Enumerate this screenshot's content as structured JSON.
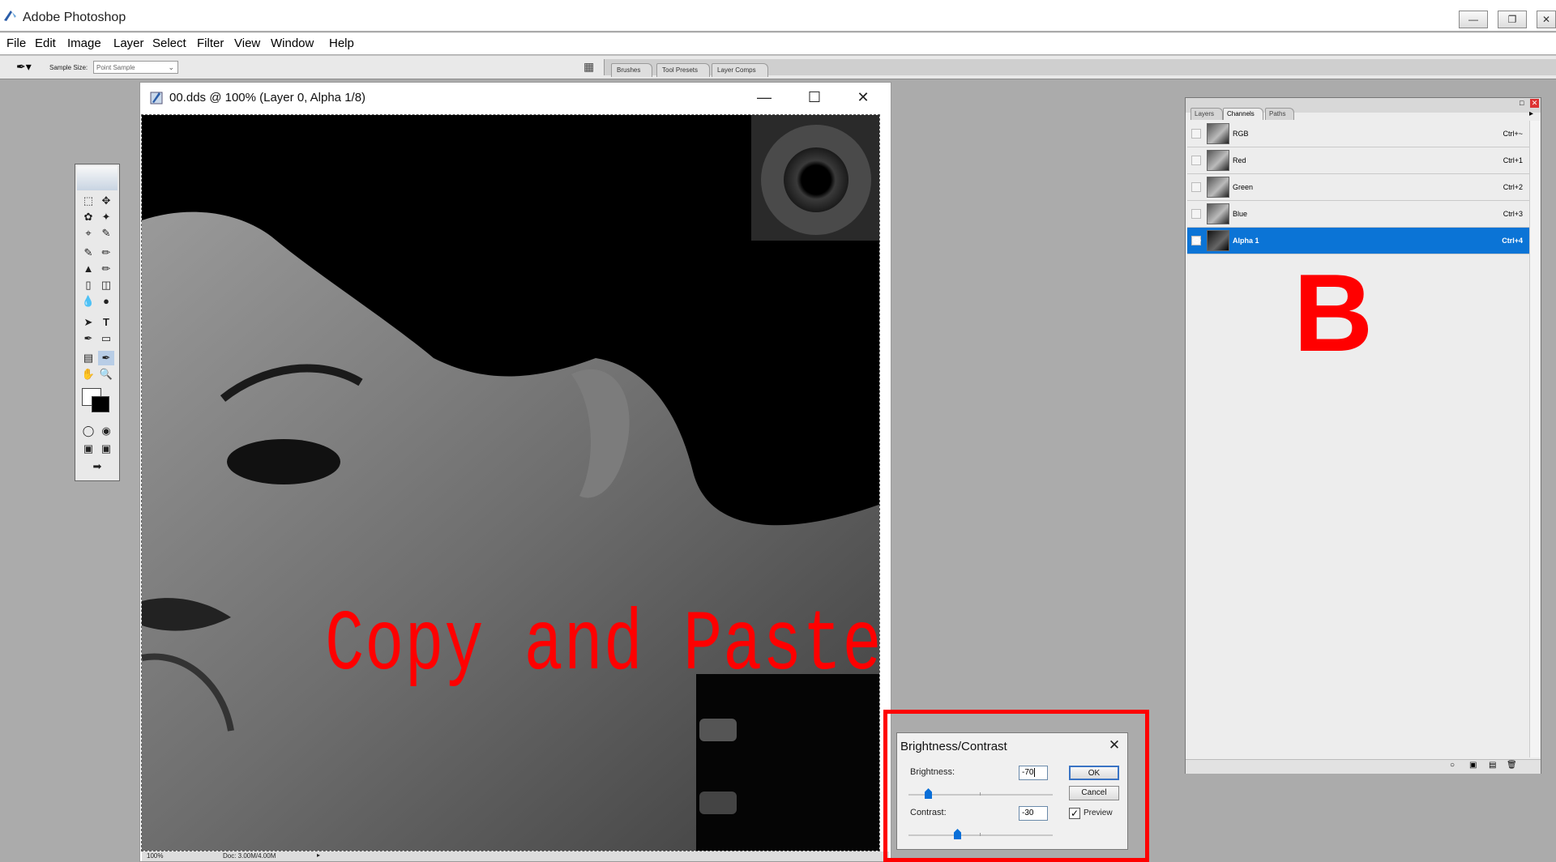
{
  "app": {
    "title": "Adobe Photoshop"
  },
  "menu": [
    "File",
    "Edit",
    "Image",
    "Layer",
    "Select",
    "Filter",
    "View",
    "Window",
    "Help"
  ],
  "options": {
    "sample_size_label": "Sample Size:",
    "sample_size_value": "Point Sample",
    "palette_well_tabs": [
      "Brushes",
      "Tool Presets",
      "Layer Comps"
    ]
  },
  "document": {
    "title": "00.dds @ 100% (Layer 0, Alpha 1/8)",
    "zoom": "100%",
    "doc_info": "Doc: 3.00M/4.00M",
    "overlay_text": "Copy and Paste"
  },
  "channels_panel": {
    "tabs": [
      "Layers",
      "Channels",
      "Paths"
    ],
    "active_tab": "Channels",
    "channels": [
      {
        "name": "RGB",
        "shortcut": "Ctrl+~",
        "visible": false
      },
      {
        "name": "Red",
        "shortcut": "Ctrl+1",
        "visible": false
      },
      {
        "name": "Green",
        "shortcut": "Ctrl+2",
        "visible": false
      },
      {
        "name": "Blue",
        "shortcut": "Ctrl+3",
        "visible": false
      },
      {
        "name": "Alpha 1",
        "shortcut": "Ctrl+4",
        "visible": true
      }
    ],
    "active_channel": "Alpha 1",
    "annotation": "B"
  },
  "dialog": {
    "title": "Brightness/Contrast",
    "brightness_label": "Brightness:",
    "brightness_value": "-70",
    "contrast_label": "Contrast:",
    "contrast_value": "-30",
    "ok_label": "OK",
    "cancel_label": "Cancel",
    "preview_label": "Preview",
    "preview_checked": true
  },
  "colors": {
    "accent": "#0b74d6",
    "annotation_red": "#ff0000",
    "workspace": "#ababab"
  }
}
